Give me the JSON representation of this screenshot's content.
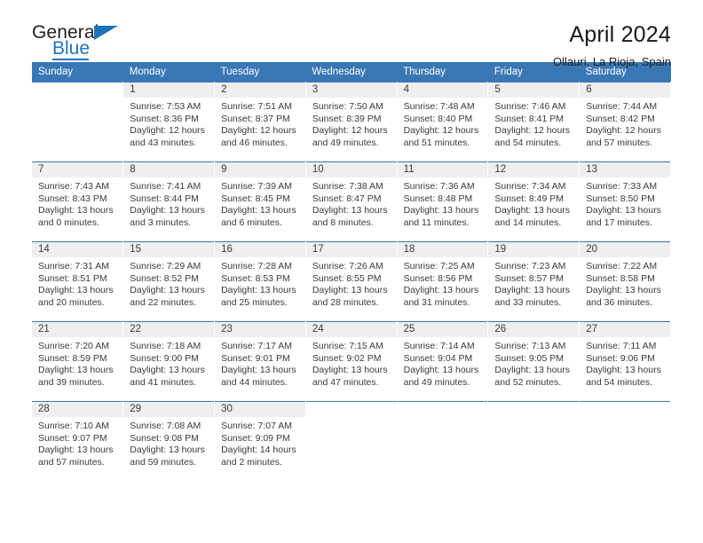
{
  "logo": {
    "word_top": "General",
    "word_bottom": "Blue",
    "accent_color": "#1e73be",
    "triangle_icon": "triangle-icon"
  },
  "header": {
    "title": "April 2024",
    "subtitle": "Ollauri, La Rioja, Spain"
  },
  "theme": {
    "header_blue": "#3a78b5",
    "daynum_band": "#efefef",
    "text": "#3a3a3a"
  },
  "calendar": {
    "weekday_headers": [
      "Sunday",
      "Monday",
      "Tuesday",
      "Wednesday",
      "Thursday",
      "Friday",
      "Saturday"
    ],
    "weeks": [
      [
        {
          "day": "",
          "sunrise": "",
          "sunset": "",
          "daylight_1": "",
          "daylight_2": ""
        },
        {
          "day": "1",
          "sunrise": "Sunrise: 7:53 AM",
          "sunset": "Sunset: 8:36 PM",
          "daylight_1": "Daylight: 12 hours",
          "daylight_2": "and 43 minutes."
        },
        {
          "day": "2",
          "sunrise": "Sunrise: 7:51 AM",
          "sunset": "Sunset: 8:37 PM",
          "daylight_1": "Daylight: 12 hours",
          "daylight_2": "and 46 minutes."
        },
        {
          "day": "3",
          "sunrise": "Sunrise: 7:50 AM",
          "sunset": "Sunset: 8:39 PM",
          "daylight_1": "Daylight: 12 hours",
          "daylight_2": "and 49 minutes."
        },
        {
          "day": "4",
          "sunrise": "Sunrise: 7:48 AM",
          "sunset": "Sunset: 8:40 PM",
          "daylight_1": "Daylight: 12 hours",
          "daylight_2": "and 51 minutes."
        },
        {
          "day": "5",
          "sunrise": "Sunrise: 7:46 AM",
          "sunset": "Sunset: 8:41 PM",
          "daylight_1": "Daylight: 12 hours",
          "daylight_2": "and 54 minutes."
        },
        {
          "day": "6",
          "sunrise": "Sunrise: 7:44 AM",
          "sunset": "Sunset: 8:42 PM",
          "daylight_1": "Daylight: 12 hours",
          "daylight_2": "and 57 minutes."
        }
      ],
      [
        {
          "day": "7",
          "sunrise": "Sunrise: 7:43 AM",
          "sunset": "Sunset: 8:43 PM",
          "daylight_1": "Daylight: 13 hours",
          "daylight_2": "and 0 minutes."
        },
        {
          "day": "8",
          "sunrise": "Sunrise: 7:41 AM",
          "sunset": "Sunset: 8:44 PM",
          "daylight_1": "Daylight: 13 hours",
          "daylight_2": "and 3 minutes."
        },
        {
          "day": "9",
          "sunrise": "Sunrise: 7:39 AM",
          "sunset": "Sunset: 8:45 PM",
          "daylight_1": "Daylight: 13 hours",
          "daylight_2": "and 6 minutes."
        },
        {
          "day": "10",
          "sunrise": "Sunrise: 7:38 AM",
          "sunset": "Sunset: 8:47 PM",
          "daylight_1": "Daylight: 13 hours",
          "daylight_2": "and 8 minutes."
        },
        {
          "day": "11",
          "sunrise": "Sunrise: 7:36 AM",
          "sunset": "Sunset: 8:48 PM",
          "daylight_1": "Daylight: 13 hours",
          "daylight_2": "and 11 minutes."
        },
        {
          "day": "12",
          "sunrise": "Sunrise: 7:34 AM",
          "sunset": "Sunset: 8:49 PM",
          "daylight_1": "Daylight: 13 hours",
          "daylight_2": "and 14 minutes."
        },
        {
          "day": "13",
          "sunrise": "Sunrise: 7:33 AM",
          "sunset": "Sunset: 8:50 PM",
          "daylight_1": "Daylight: 13 hours",
          "daylight_2": "and 17 minutes."
        }
      ],
      [
        {
          "day": "14",
          "sunrise": "Sunrise: 7:31 AM",
          "sunset": "Sunset: 8:51 PM",
          "daylight_1": "Daylight: 13 hours",
          "daylight_2": "and 20 minutes."
        },
        {
          "day": "15",
          "sunrise": "Sunrise: 7:29 AM",
          "sunset": "Sunset: 8:52 PM",
          "daylight_1": "Daylight: 13 hours",
          "daylight_2": "and 22 minutes."
        },
        {
          "day": "16",
          "sunrise": "Sunrise: 7:28 AM",
          "sunset": "Sunset: 8:53 PM",
          "daylight_1": "Daylight: 13 hours",
          "daylight_2": "and 25 minutes."
        },
        {
          "day": "17",
          "sunrise": "Sunrise: 7:26 AM",
          "sunset": "Sunset: 8:55 PM",
          "daylight_1": "Daylight: 13 hours",
          "daylight_2": "and 28 minutes."
        },
        {
          "day": "18",
          "sunrise": "Sunrise: 7:25 AM",
          "sunset": "Sunset: 8:56 PM",
          "daylight_1": "Daylight: 13 hours",
          "daylight_2": "and 31 minutes."
        },
        {
          "day": "19",
          "sunrise": "Sunrise: 7:23 AM",
          "sunset": "Sunset: 8:57 PM",
          "daylight_1": "Daylight: 13 hours",
          "daylight_2": "and 33 minutes."
        },
        {
          "day": "20",
          "sunrise": "Sunrise: 7:22 AM",
          "sunset": "Sunset: 8:58 PM",
          "daylight_1": "Daylight: 13 hours",
          "daylight_2": "and 36 minutes."
        }
      ],
      [
        {
          "day": "21",
          "sunrise": "Sunrise: 7:20 AM",
          "sunset": "Sunset: 8:59 PM",
          "daylight_1": "Daylight: 13 hours",
          "daylight_2": "and 39 minutes."
        },
        {
          "day": "22",
          "sunrise": "Sunrise: 7:18 AM",
          "sunset": "Sunset: 9:00 PM",
          "daylight_1": "Daylight: 13 hours",
          "daylight_2": "and 41 minutes."
        },
        {
          "day": "23",
          "sunrise": "Sunrise: 7:17 AM",
          "sunset": "Sunset: 9:01 PM",
          "daylight_1": "Daylight: 13 hours",
          "daylight_2": "and 44 minutes."
        },
        {
          "day": "24",
          "sunrise": "Sunrise: 7:15 AM",
          "sunset": "Sunset: 9:02 PM",
          "daylight_1": "Daylight: 13 hours",
          "daylight_2": "and 47 minutes."
        },
        {
          "day": "25",
          "sunrise": "Sunrise: 7:14 AM",
          "sunset": "Sunset: 9:04 PM",
          "daylight_1": "Daylight: 13 hours",
          "daylight_2": "and 49 minutes."
        },
        {
          "day": "26",
          "sunrise": "Sunrise: 7:13 AM",
          "sunset": "Sunset: 9:05 PM",
          "daylight_1": "Daylight: 13 hours",
          "daylight_2": "and 52 minutes."
        },
        {
          "day": "27",
          "sunrise": "Sunrise: 7:11 AM",
          "sunset": "Sunset: 9:06 PM",
          "daylight_1": "Daylight: 13 hours",
          "daylight_2": "and 54 minutes."
        }
      ],
      [
        {
          "day": "28",
          "sunrise": "Sunrise: 7:10 AM",
          "sunset": "Sunset: 9:07 PM",
          "daylight_1": "Daylight: 13 hours",
          "daylight_2": "and 57 minutes."
        },
        {
          "day": "29",
          "sunrise": "Sunrise: 7:08 AM",
          "sunset": "Sunset: 9:08 PM",
          "daylight_1": "Daylight: 13 hours",
          "daylight_2": "and 59 minutes."
        },
        {
          "day": "30",
          "sunrise": "Sunrise: 7:07 AM",
          "sunset": "Sunset: 9:09 PM",
          "daylight_1": "Daylight: 14 hours",
          "daylight_2": "and 2 minutes."
        },
        {
          "day": "",
          "sunrise": "",
          "sunset": "",
          "daylight_1": "",
          "daylight_2": ""
        },
        {
          "day": "",
          "sunrise": "",
          "sunset": "",
          "daylight_1": "",
          "daylight_2": ""
        },
        {
          "day": "",
          "sunrise": "",
          "sunset": "",
          "daylight_1": "",
          "daylight_2": ""
        },
        {
          "day": "",
          "sunrise": "",
          "sunset": "",
          "daylight_1": "",
          "daylight_2": ""
        }
      ]
    ]
  }
}
